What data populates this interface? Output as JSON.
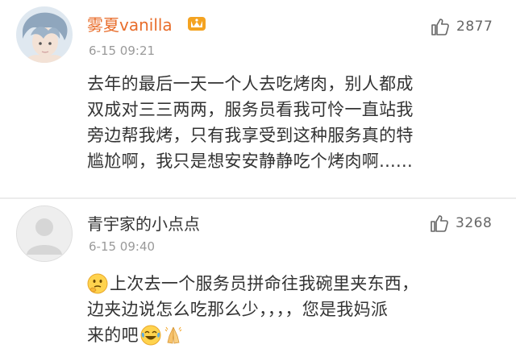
{
  "comments": [
    {
      "username": "雾夏vanilla",
      "time": "6-15 09:21",
      "like_count": "2877",
      "text_lines": [
        "去年的最后一天一个人去吃烤肉，别人都成",
        "双成对三三两两，服务员看我可怜一直站我",
        "旁边帮我烤，只有我享受到这种服务真的特",
        "尴尬啊，我只是想安安静静吃个烤肉啊......"
      ],
      "badge_icon": "vip-crown-icon"
    },
    {
      "username": "青宇家的小点点",
      "time": "6-15 09:40",
      "like_count": "3268",
      "text_lines": [
        "上次去一个服务员拼命往我碗里夹东西，",
        "边夹边说怎么吃那么少，，，，您是我妈派",
        "来的吧"
      ],
      "emojis": [
        "thinking-emoji",
        "laughing-tears-emoji",
        "pray-emoji"
      ]
    }
  ],
  "colors": {
    "username_highlight": "#e86d2b",
    "text": "#333333",
    "meta": "#9a9a9a"
  }
}
